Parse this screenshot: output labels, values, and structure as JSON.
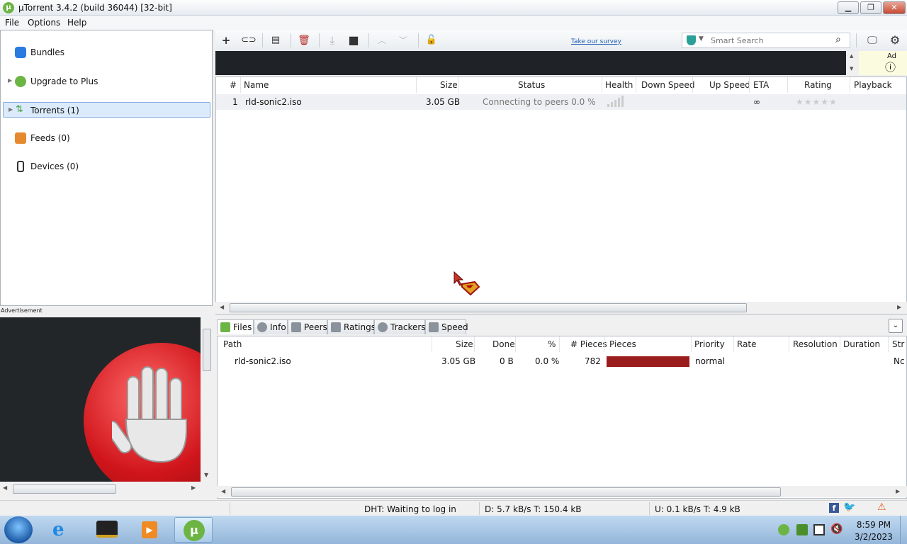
{
  "window": {
    "title": "µTorrent 3.4.2  (build 36044) [32-bit]",
    "controls": {
      "minimize": "▁",
      "maximize": "❐",
      "close": "✕"
    }
  },
  "menu": [
    "File",
    "Options",
    "Help"
  ],
  "sidebar": {
    "items": [
      {
        "label": "Bundles",
        "icon": "bundles-icon",
        "color": "#2a7be0"
      },
      {
        "label": "Upgrade to Plus",
        "icon": "utorrent-icon",
        "color": "#6cb544"
      },
      {
        "label": "Torrents (1)",
        "icon": "torrents-icon",
        "color": "#3c9a3c"
      },
      {
        "label": "Feeds (0)",
        "icon": "rss-icon",
        "color": "#e58a2e"
      },
      {
        "label": "Devices (0)",
        "icon": "device-icon",
        "color": "#333333"
      }
    ],
    "ad_label": "Advertisement"
  },
  "toolbar": {
    "survey_link": "Take our survey",
    "search_placeholder": "Smart Search",
    "ad_label": "Ad",
    "ad_info": "ⓘ"
  },
  "torrent_list": {
    "columns": [
      "#",
      "Name",
      "Size",
      "Status",
      "Health",
      "Down Speed",
      "Up Speed",
      "ETA",
      "Rating",
      "Playback"
    ],
    "rows": [
      {
        "num": "1",
        "name": "rld-sonic2.iso",
        "size": "3.05 GB",
        "status": "Connecting to peers 0.0 %",
        "health": "",
        "down": "",
        "up": "",
        "eta": "∞",
        "rating": "★★★★★",
        "playback": ""
      }
    ]
  },
  "tabs": [
    "Files",
    "Info",
    "Peers",
    "Ratings",
    "Trackers",
    "Speed"
  ],
  "files": {
    "columns": [
      "Path",
      "Size",
      "Done",
      "%",
      "# Pieces",
      "Pieces",
      "Priority",
      "Rate",
      "Resolution",
      "Duration",
      "Str"
    ],
    "rows": [
      {
        "path": "rld-sonic2.iso",
        "size": "3.05 GB",
        "done": "0 B",
        "percent": "0.0 %",
        "pieces": "782",
        "priority": "normal",
        "str": "Nc"
      }
    ],
    "pieces_color": "#9b1c1c"
  },
  "status": {
    "dht": "DHT: Waiting to log in",
    "down": "D: 5.7 kB/s T: 150.4 kB",
    "up": "U: 0.1 kB/s T: 4.9 kB"
  },
  "taskbar": {
    "time": "8:59 PM",
    "date": "3/2/2023"
  },
  "colors": {
    "accent": "#6cb544",
    "selection": "#dcebfc",
    "link": "#1f5fb5"
  }
}
